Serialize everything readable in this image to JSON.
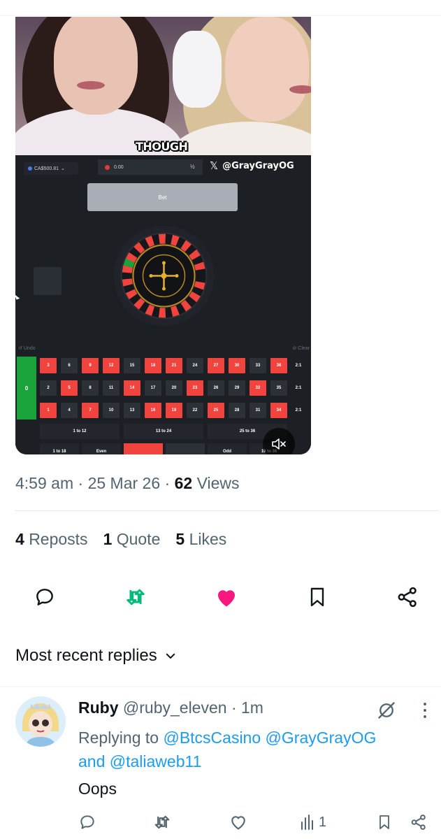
{
  "video": {
    "caption": "THOUGH",
    "watermark_handle": "@GrayGrayOG",
    "watermark_icon": "x-logo-icon",
    "game": {
      "balance": "CA$500.81",
      "bet_amount": "0.00",
      "half_label": "½",
      "bet_label": "Bet",
      "undo_label": "Undo",
      "clear_label": "Clear",
      "zero_label": "0",
      "rows": [
        [
          {
            "n": "3",
            "c": "red"
          },
          {
            "n": "6",
            "c": "black"
          },
          {
            "n": "9",
            "c": "red"
          },
          {
            "n": "12",
            "c": "red"
          },
          {
            "n": "15",
            "c": "black"
          },
          {
            "n": "18",
            "c": "red"
          },
          {
            "n": "21",
            "c": "red"
          },
          {
            "n": "24",
            "c": "black"
          },
          {
            "n": "27",
            "c": "red"
          },
          {
            "n": "30",
            "c": "red"
          },
          {
            "n": "33",
            "c": "black"
          },
          {
            "n": "36",
            "c": "red"
          }
        ],
        [
          {
            "n": "2",
            "c": "black"
          },
          {
            "n": "5",
            "c": "red"
          },
          {
            "n": "8",
            "c": "black"
          },
          {
            "n": "11",
            "c": "black"
          },
          {
            "n": "14",
            "c": "red"
          },
          {
            "n": "17",
            "c": "black"
          },
          {
            "n": "20",
            "c": "black"
          },
          {
            "n": "23",
            "c": "red"
          },
          {
            "n": "26",
            "c": "black"
          },
          {
            "n": "29",
            "c": "black"
          },
          {
            "n": "32",
            "c": "red"
          },
          {
            "n": "35",
            "c": "black"
          }
        ],
        [
          {
            "n": "1",
            "c": "red"
          },
          {
            "n": "4",
            "c": "black"
          },
          {
            "n": "7",
            "c": "red"
          },
          {
            "n": "10",
            "c": "black"
          },
          {
            "n": "13",
            "c": "black"
          },
          {
            "n": "16",
            "c": "red"
          },
          {
            "n": "19",
            "c": "red"
          },
          {
            "n": "22",
            "c": "black"
          },
          {
            "n": "25",
            "c": "red"
          },
          {
            "n": "28",
            "c": "black"
          },
          {
            "n": "31",
            "c": "black"
          },
          {
            "n": "34",
            "c": "red"
          }
        ]
      ],
      "column_label": "2:1",
      "dozens": [
        "1 to 12",
        "13 to 24",
        "25 to 36"
      ],
      "outside": [
        "1 to 18",
        "Even",
        "",
        "",
        "Odd",
        "19 to 36"
      ],
      "colors": {
        "red": "#f1443f",
        "black": "#2c3037",
        "green": "#1aa33a"
      }
    }
  },
  "meta": {
    "time": "4:59 am",
    "date": "25 Mar 26",
    "views_count": "62",
    "views_label": "Views",
    "sep": "·"
  },
  "stats": {
    "reposts_count": "4",
    "reposts_label": "Reposts",
    "quotes_count": "1",
    "quotes_label": "Quote",
    "likes_count": "5",
    "likes_label": "Likes"
  },
  "actions": {
    "icons": [
      "reply-icon",
      "repost-icon",
      "like-icon",
      "bookmark-icon",
      "share-icon"
    ],
    "repost_color": "#00ba7c",
    "like_color": "#f91880"
  },
  "replies": {
    "sort_label": "Most recent replies",
    "items": [
      {
        "name": "Ruby",
        "handle": "@ruby_eleven",
        "time": "1m",
        "replying_prefix": "Replying to",
        "mention1": "@BtcsCasino",
        "mention2": "@GrayGrayOG",
        "and_word": "and",
        "mention3": "@taliaweb11",
        "text": "Oops",
        "views": "1"
      }
    ]
  }
}
